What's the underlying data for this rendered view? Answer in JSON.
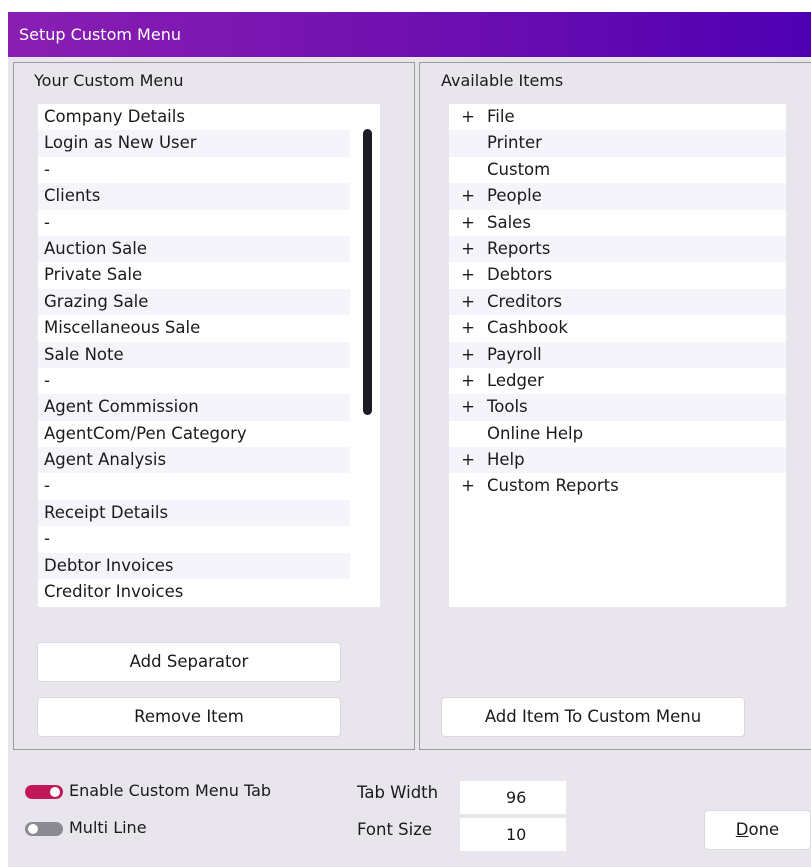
{
  "window": {
    "title": "Setup Custom Menu"
  },
  "custom_menu": {
    "title": "Your Custom Menu",
    "items": [
      "Company Details",
      "Login as New User",
      "-",
      "Clients",
      "-",
      "Auction Sale",
      "Private Sale",
      "Grazing Sale",
      "Miscellaneous Sale",
      "Sale Note",
      "-",
      "Agent Commission",
      "AgentCom/Pen Category",
      "Agent Analysis",
      "-",
      "Receipt Details",
      "-",
      "Debtor Invoices",
      "Creditor Invoices"
    ]
  },
  "available_items": {
    "title": "Available Items",
    "items": [
      {
        "expander": "+",
        "label": "File"
      },
      {
        "expander": "",
        "label": "Printer"
      },
      {
        "expander": "",
        "label": "Custom"
      },
      {
        "expander": "+",
        "label": "People"
      },
      {
        "expander": "+",
        "label": "Sales"
      },
      {
        "expander": "+",
        "label": "Reports"
      },
      {
        "expander": "+",
        "label": "Debtors"
      },
      {
        "expander": "+",
        "label": "Creditors"
      },
      {
        "expander": "+",
        "label": "Cashbook"
      },
      {
        "expander": "+",
        "label": "Payroll"
      },
      {
        "expander": "+",
        "label": "Ledger"
      },
      {
        "expander": "+",
        "label": "Tools"
      },
      {
        "expander": "",
        "label": "Online Help"
      },
      {
        "expander": "+",
        "label": "Help"
      },
      {
        "expander": "+",
        "label": "Custom Reports"
      }
    ]
  },
  "buttons": {
    "add_separator": "Add Separator",
    "remove_item": "Remove Item",
    "add_item": "Add Item To Custom Menu",
    "done_mnemonic": "D",
    "done_rest": "one"
  },
  "options": {
    "enable_custom_menu_tab": {
      "label": "Enable Custom Menu Tab",
      "state": "on"
    },
    "multi_line": {
      "label": "Multi Line",
      "state": "off"
    },
    "tab_width": {
      "label": "Tab Width",
      "value": "96"
    },
    "font_size": {
      "label": "Font Size",
      "value": "10"
    }
  },
  "colors": {
    "title_gradient": [
      "#8a1fb3",
      "#4f00b2"
    ],
    "toggle_on": "#c2185b",
    "toggle_off": "#8a8a90",
    "dialog_bg": "#e8e6ec"
  }
}
